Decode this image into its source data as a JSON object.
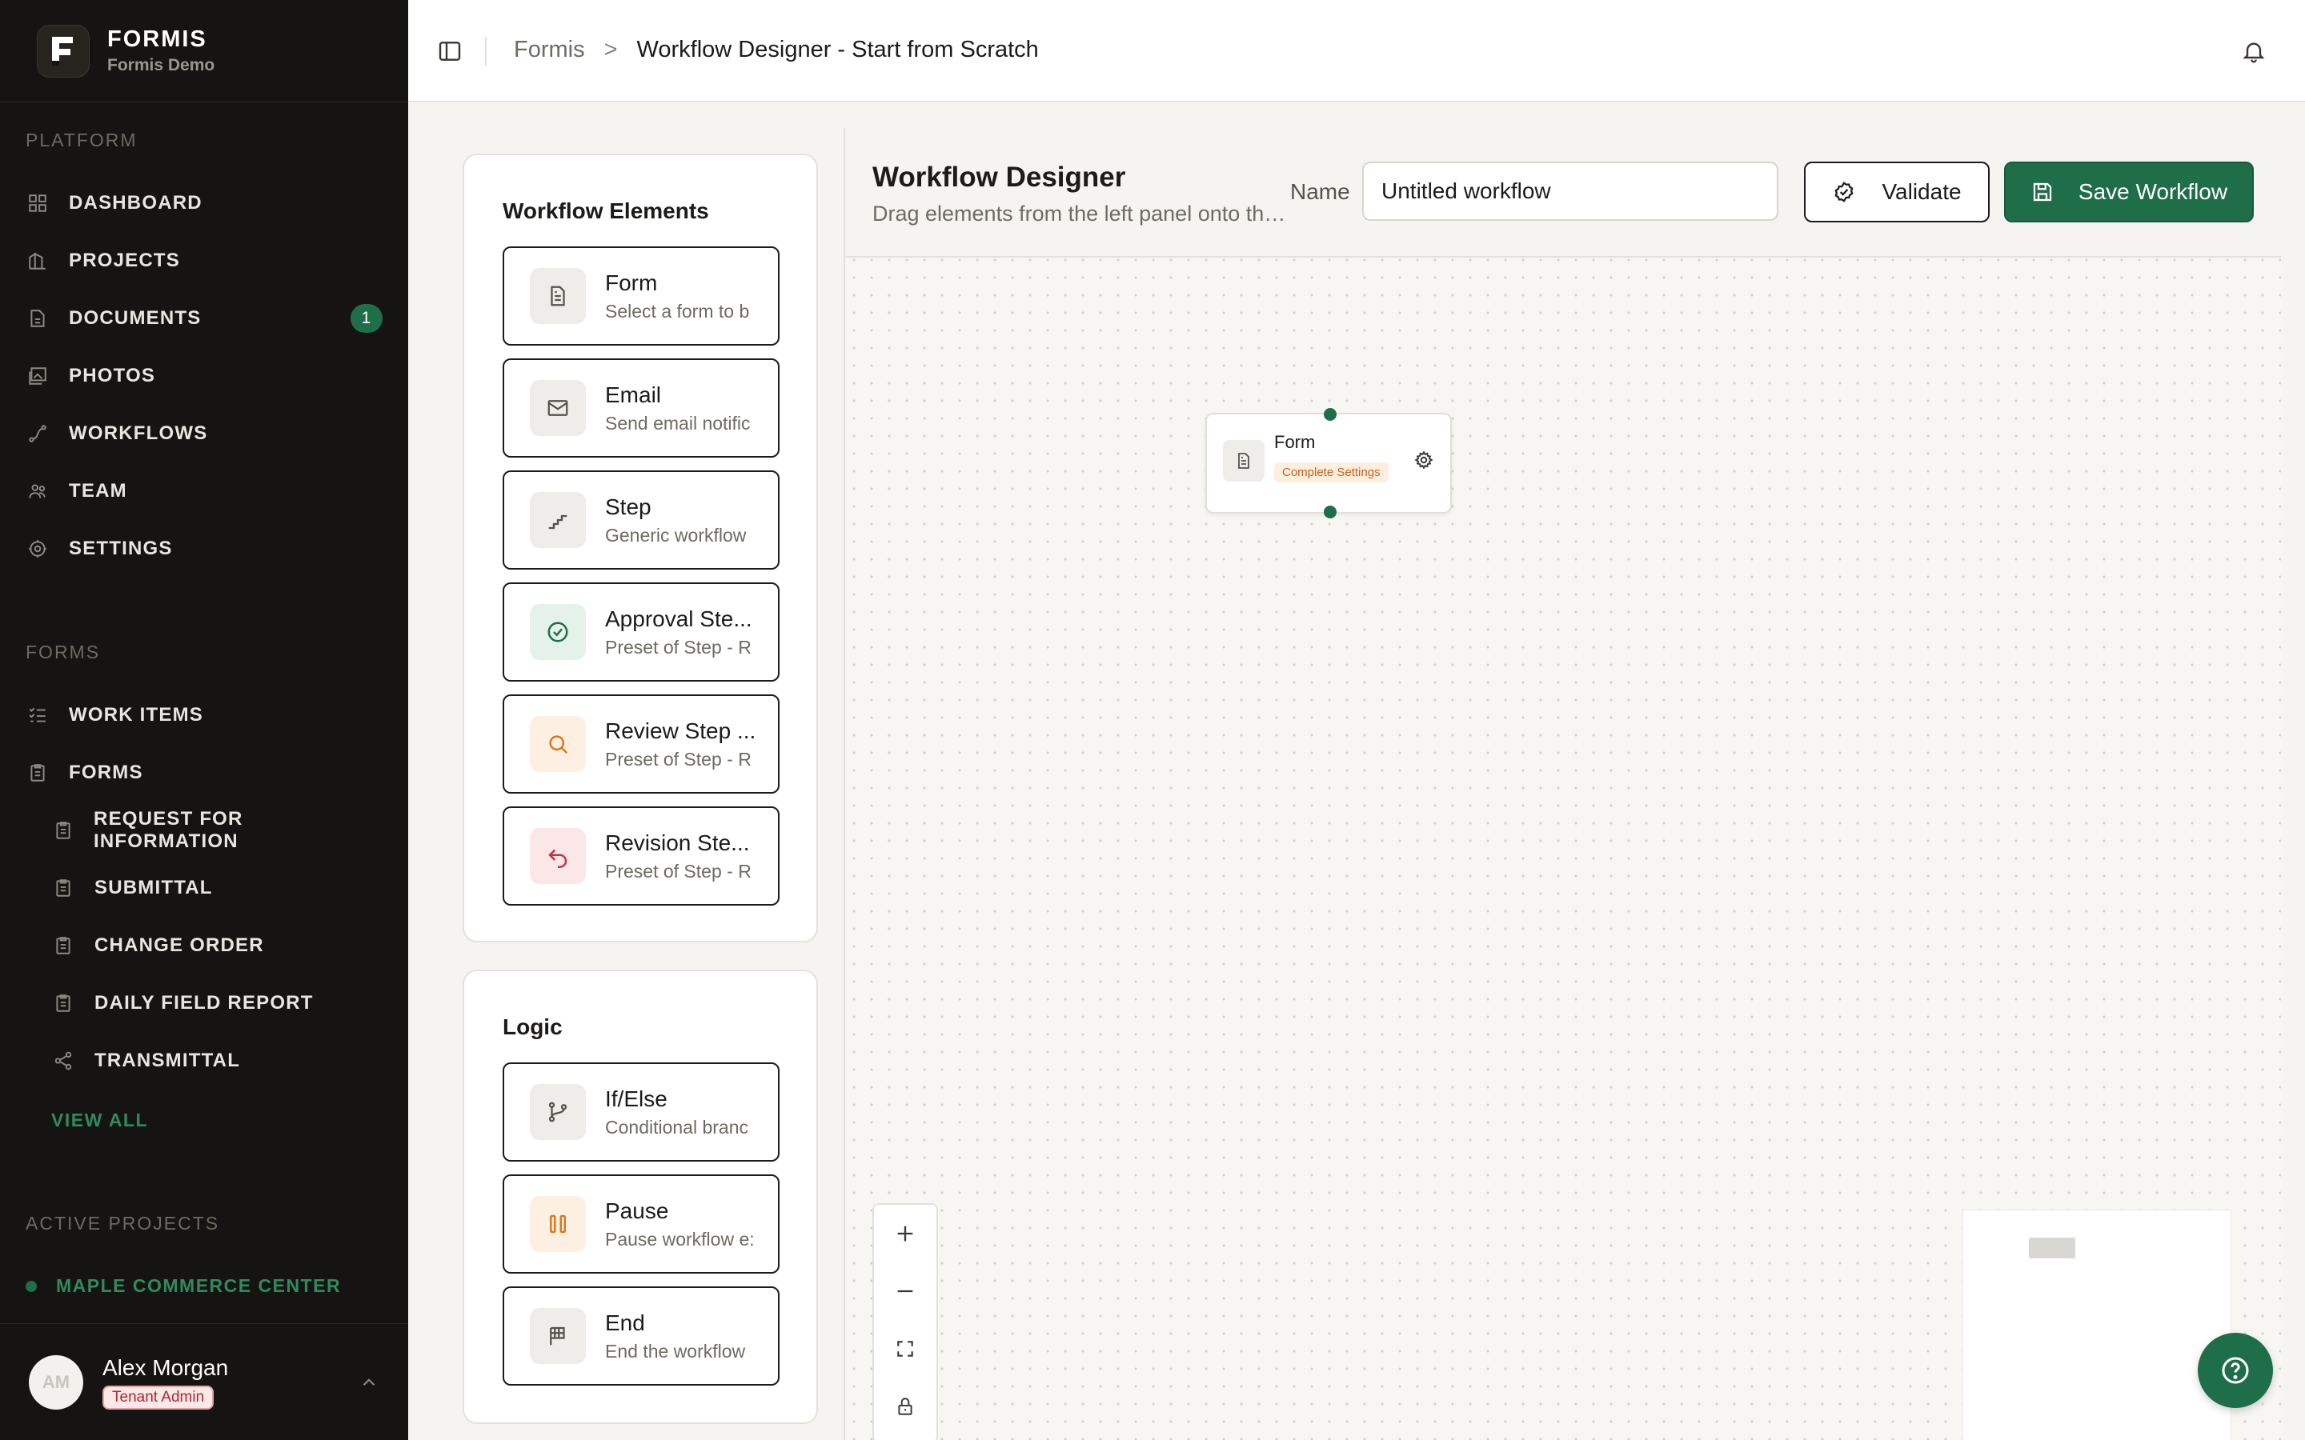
{
  "brand": {
    "name": "FORMIS",
    "subtitle": "Formis Demo",
    "logo_letter": "F"
  },
  "sidebar": {
    "platform_label": "PLATFORM",
    "platform_items": [
      {
        "label": "DASHBOARD",
        "icon": "dashboard-icon"
      },
      {
        "label": "PROJECTS",
        "icon": "building-icon"
      },
      {
        "label": "DOCUMENTS",
        "icon": "document-icon",
        "badge": "1"
      },
      {
        "label": "PHOTOS",
        "icon": "photos-icon"
      },
      {
        "label": "WORKFLOWS",
        "icon": "workflow-icon"
      },
      {
        "label": "TEAM",
        "icon": "team-icon"
      },
      {
        "label": "SETTINGS",
        "icon": "gear-icon"
      }
    ],
    "forms_label": "FORMS",
    "forms_items": [
      {
        "label": "WORK ITEMS",
        "icon": "list-checks-icon"
      },
      {
        "label": "FORMS",
        "icon": "clipboard-icon"
      }
    ],
    "form_sub_items": [
      {
        "label": "REQUEST FOR INFORMATION",
        "icon": "clipboard-icon"
      },
      {
        "label": "SUBMITTAL",
        "icon": "clipboard-icon"
      },
      {
        "label": "CHANGE ORDER",
        "icon": "clipboard-icon"
      },
      {
        "label": "DAILY FIELD REPORT",
        "icon": "clipboard-icon"
      },
      {
        "label": "TRANSMITTAL",
        "icon": "share-icon"
      }
    ],
    "view_all": "VIEW ALL",
    "active_projects_label": "ACTIVE PROJECTS",
    "active_projects": [
      {
        "label": "MAPLE COMMERCE CENTER"
      }
    ],
    "user": {
      "initials": "AM",
      "name": "Alex Morgan",
      "role": "Tenant Admin"
    }
  },
  "topbar": {
    "breadcrumb_root": "Formis",
    "breadcrumb_separator": ">",
    "breadcrumb_current": "Workflow Designer - Start from Scratch"
  },
  "elements_panel": {
    "title": "Workflow Elements",
    "items": [
      {
        "title": "Form",
        "desc": "Select a form to b",
        "icon": "form-icon"
      },
      {
        "title": "Email",
        "desc": "Send email notific",
        "icon": "mail-icon"
      },
      {
        "title": "Step",
        "desc": "Generic workflow",
        "icon": "stairs-icon"
      },
      {
        "title": "Approval Ste...",
        "desc": "Preset of Step - R",
        "icon": "check-circle-icon"
      },
      {
        "title": "Review Step ...",
        "desc": "Preset of Step - R",
        "icon": "search-icon"
      },
      {
        "title": "Revision Ste...",
        "desc": "Preset of Step - R",
        "icon": "undo-icon"
      }
    ]
  },
  "logic_panel": {
    "title": "Logic",
    "items": [
      {
        "title": "If/Else",
        "desc": "Conditional branc",
        "icon": "branch-icon"
      },
      {
        "title": "Pause",
        "desc": "Pause workflow e:",
        "icon": "pause-icon"
      },
      {
        "title": "End",
        "desc": "End the workflow",
        "icon": "flag-icon"
      }
    ]
  },
  "designer": {
    "title": "Workflow Designer",
    "subtitle": "Drag elements from the left panel onto the canvas",
    "name_label": "Name",
    "name_value": "Untitled workflow",
    "validate_label": "Validate",
    "save_label": "Save Workflow"
  },
  "canvas": {
    "node": {
      "title": "Form",
      "badge": "Complete Settings",
      "icon": "form-icon"
    },
    "zoom_controls": [
      "plus-icon",
      "minus-icon",
      "fit-view-icon",
      "lock-icon"
    ]
  },
  "colors": {
    "sidebar_bg": "#161412",
    "accent": "#1f6e4a",
    "warning_badge": "#c2621b",
    "danger": "#c4353d"
  }
}
